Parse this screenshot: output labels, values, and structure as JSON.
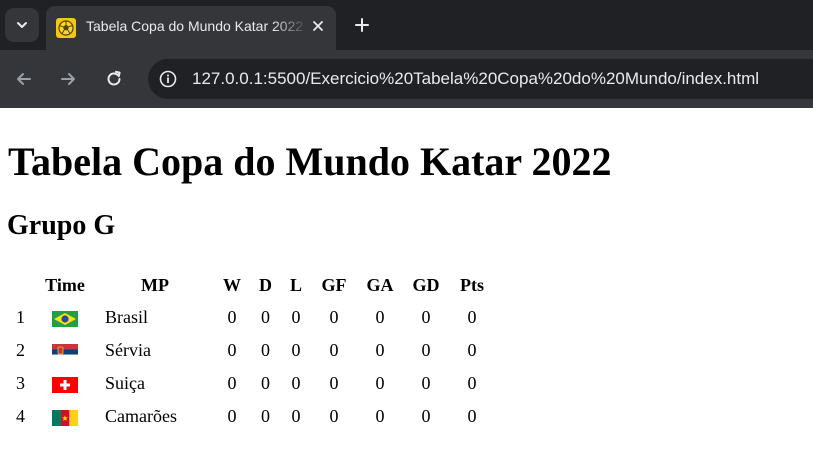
{
  "browser": {
    "tab_title": "Tabela Copa do Mundo Katar 2022",
    "url": "127.0.0.1:5500/Exercicio%20Tabela%20Copa%20do%20Mundo/index.html",
    "icons": {
      "tab_menu": "chevron-down-icon",
      "favicon": "soccer-ball-icon",
      "close": "close-icon",
      "new_tab": "plus-icon",
      "back": "back-arrow-icon",
      "forward": "forward-arrow-icon",
      "reload": "reload-icon",
      "site_info": "info-icon"
    }
  },
  "page": {
    "title": "Tabela Copa do Mundo Katar 2022",
    "group_title": "Grupo G",
    "table": {
      "headers": [
        "",
        "Time",
        "MP",
        "W",
        "D",
        "L",
        "GF",
        "GA",
        "GD",
        "Pts"
      ],
      "rows": [
        {
          "pos": "1",
          "flag": "brazil-flag",
          "team": "Brasil",
          "mp": "0",
          "w": "0",
          "d": "0",
          "l": "0",
          "gf": "0",
          "ga": "0",
          "gd": "0"
        },
        {
          "pos": "2",
          "flag": "serbia-flag",
          "team": "Sérvia",
          "mp": "0",
          "w": "0",
          "d": "0",
          "l": "0",
          "gf": "0",
          "ga": "0",
          "gd": "0"
        },
        {
          "pos": "3",
          "flag": "switzerland-flag",
          "team": "Suiça",
          "mp": "0",
          "w": "0",
          "d": "0",
          "l": "0",
          "gf": "0",
          "ga": "0",
          "gd": "0"
        },
        {
          "pos": "4",
          "flag": "cameroon-flag",
          "team": "Camarões",
          "mp": "0",
          "w": "0",
          "d": "0",
          "l": "0",
          "gf": "0",
          "ga": "0",
          "gd": "0"
        }
      ]
    }
  },
  "colors": {
    "chrome_dark": "#202124",
    "chrome_tab": "#35363a",
    "chrome_text": "#e8eaed",
    "page_bg": "#ffffff"
  }
}
